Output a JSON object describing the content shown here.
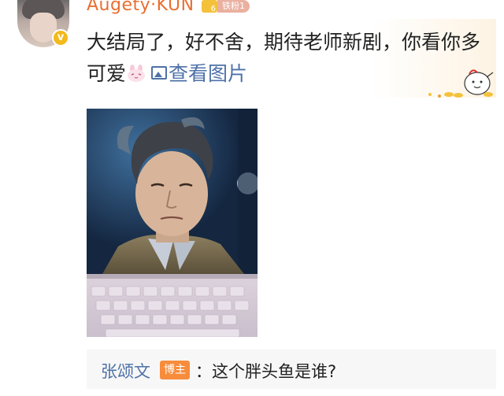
{
  "comment": {
    "username": "Augety·KUN",
    "verified_mark": "v",
    "level_number": "6",
    "fan_badge": "铁粉1",
    "text": "大结局了，好不舍，期待老师新剧，你看你多可爱",
    "view_image_label": "查看图片"
  },
  "reply": {
    "author": "张颂文",
    "author_tag": "博主",
    "text": "：这个胖头鱼是谁?"
  },
  "icons": {
    "avatar": "user-avatar",
    "verified": "verified-icon",
    "emoji": "rabbit-emoji",
    "picture": "picture-icon",
    "sticker": "mascot-sticker"
  },
  "colors": {
    "username": "#e96f2f",
    "link": "#4e71a8",
    "blogger_badge": "#f78c3c",
    "verified": "#f3b91d",
    "reply_bg": "#f7f7f7"
  }
}
